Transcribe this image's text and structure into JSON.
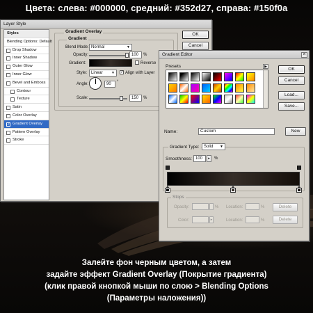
{
  "colors": {
    "left": "#000000",
    "middle": "#352d27",
    "right": "#150f0a",
    "selection": "#316ac5"
  },
  "header": {
    "text": "Цвета: слева: #000000, средний: #352d27, справа: #150f0a"
  },
  "layer_style": {
    "title": "Layer Style",
    "styles_header": "Styles",
    "items": [
      {
        "label": "Blending Options: Default",
        "checked": false,
        "selected": false,
        "sub": false,
        "has_checkbox": false
      },
      {
        "label": "Drop Shadow",
        "checked": false,
        "selected": false,
        "sub": false,
        "has_checkbox": true
      },
      {
        "label": "Inner Shadow",
        "checked": false,
        "selected": false,
        "sub": false,
        "has_checkbox": true
      },
      {
        "label": "Outer Glow",
        "checked": false,
        "selected": false,
        "sub": false,
        "has_checkbox": true
      },
      {
        "label": "Inner Glow",
        "checked": false,
        "selected": false,
        "sub": false,
        "has_checkbox": true
      },
      {
        "label": "Bevel and Emboss",
        "checked": false,
        "selected": false,
        "sub": false,
        "has_checkbox": true
      },
      {
        "label": "Contour",
        "checked": false,
        "selected": false,
        "sub": true,
        "has_checkbox": true
      },
      {
        "label": "Texture",
        "checked": false,
        "selected": false,
        "sub": true,
        "has_checkbox": true
      },
      {
        "label": "Satin",
        "checked": false,
        "selected": false,
        "sub": false,
        "has_checkbox": true
      },
      {
        "label": "Color Overlay",
        "checked": false,
        "selected": false,
        "sub": false,
        "has_checkbox": true
      },
      {
        "label": "Gradient Overlay",
        "checked": true,
        "selected": true,
        "sub": false,
        "has_checkbox": true
      },
      {
        "label": "Pattern Overlay",
        "checked": false,
        "selected": false,
        "sub": false,
        "has_checkbox": true
      },
      {
        "label": "Stroke",
        "checked": false,
        "selected": false,
        "sub": false,
        "has_checkbox": true
      }
    ],
    "section_title": "Gradient Overlay",
    "subsection_title": "Gradient",
    "blend_mode_label": "Blend Mode:",
    "blend_mode_value": "Normal",
    "opacity_label": "Opacity:",
    "opacity_value": "100",
    "opacity_unit": "%",
    "gradient_label": "Gradient:",
    "reverse_label": "Reverse",
    "style_label": "Style:",
    "style_value": "Linear",
    "align_label": "Align with Layer",
    "angle_label": "Angle:",
    "angle_value": "90",
    "angle_unit": "°",
    "scale_label": "Scale:",
    "scale_value": "150",
    "scale_unit": "%",
    "ok": "OK",
    "cancel": "Cancel"
  },
  "gradient_editor": {
    "title": "Gradient Editor",
    "presets_label": "Presets",
    "ok": "OK",
    "cancel": "Cancel",
    "load": "Load...",
    "save": "Save...",
    "name_label": "Name:",
    "name_value": "Custom",
    "new_label": "New",
    "type_label": "Gradient Type:",
    "type_value": "Solid",
    "smoothness_label": "Smoothness:",
    "smoothness_value": "100",
    "smoothness_unit": "%",
    "stops_title": "Stops",
    "opacity_label": "Opacity:",
    "opacity_unit": "%",
    "location_label": "Location:",
    "location_unit": "%",
    "delete_label": "Delete",
    "color_label": "Color:",
    "preset_swatches": [
      "linear-gradient(135deg,#000,#fff)",
      "linear-gradient(135deg,#000,#000 20%,rgba(0,0,0,0))",
      "linear-gradient(135deg,#000,#fff)",
      "linear-gradient(135deg,#fff,#000)",
      "linear-gradient(135deg,#000,#f00)",
      "linear-gradient(135deg,#f0f,#00f)",
      "linear-gradient(135deg,#f00,#ff0,#0f0)",
      "linear-gradient(135deg,#ff0,#f80)",
      "linear-gradient(135deg,#ffd000,#ff7a00)",
      "linear-gradient(135deg,#f60,#fff,#f60)",
      "linear-gradient(135deg,#a0f,#f0a)",
      "linear-gradient(135deg,#0060ff,#00d0ff)",
      "linear-gradient(135deg,#d04000,#ffd000,#d04000)",
      "linear-gradient(135deg,#f00,#ff0,#0f0,#0ff,#00f,#f0f)",
      "linear-gradient(135deg,#f80,#ff4)",
      "linear-gradient(135deg,#ff8c00,#ffe7a0)",
      "linear-gradient(135deg,#06f,#fff,#06f)",
      "linear-gradient(135deg,#0c0,#ff0,#f00)",
      "linear-gradient(135deg,#f00,#00f)",
      "linear-gradient(135deg,#ffe000,#ff6000)",
      "linear-gradient(135deg,#0f0,#00f,#f0f)",
      "linear-gradient(135deg,#ccc,#fff,#888)",
      "linear-gradient(135deg,#f44,#ffa,#4f4)",
      "linear-gradient(135deg,#f0f,#ff0,#0ff)"
    ]
  },
  "caption": {
    "line1": "Залейте фон черным цветом, а затем",
    "line2": "задайте эффект Gradient Overlay (Покрытие градиента)",
    "line3": "(клик правой кнопкой мыши по слою > Blending Options",
    "line4": "(Параметры наложения))"
  }
}
